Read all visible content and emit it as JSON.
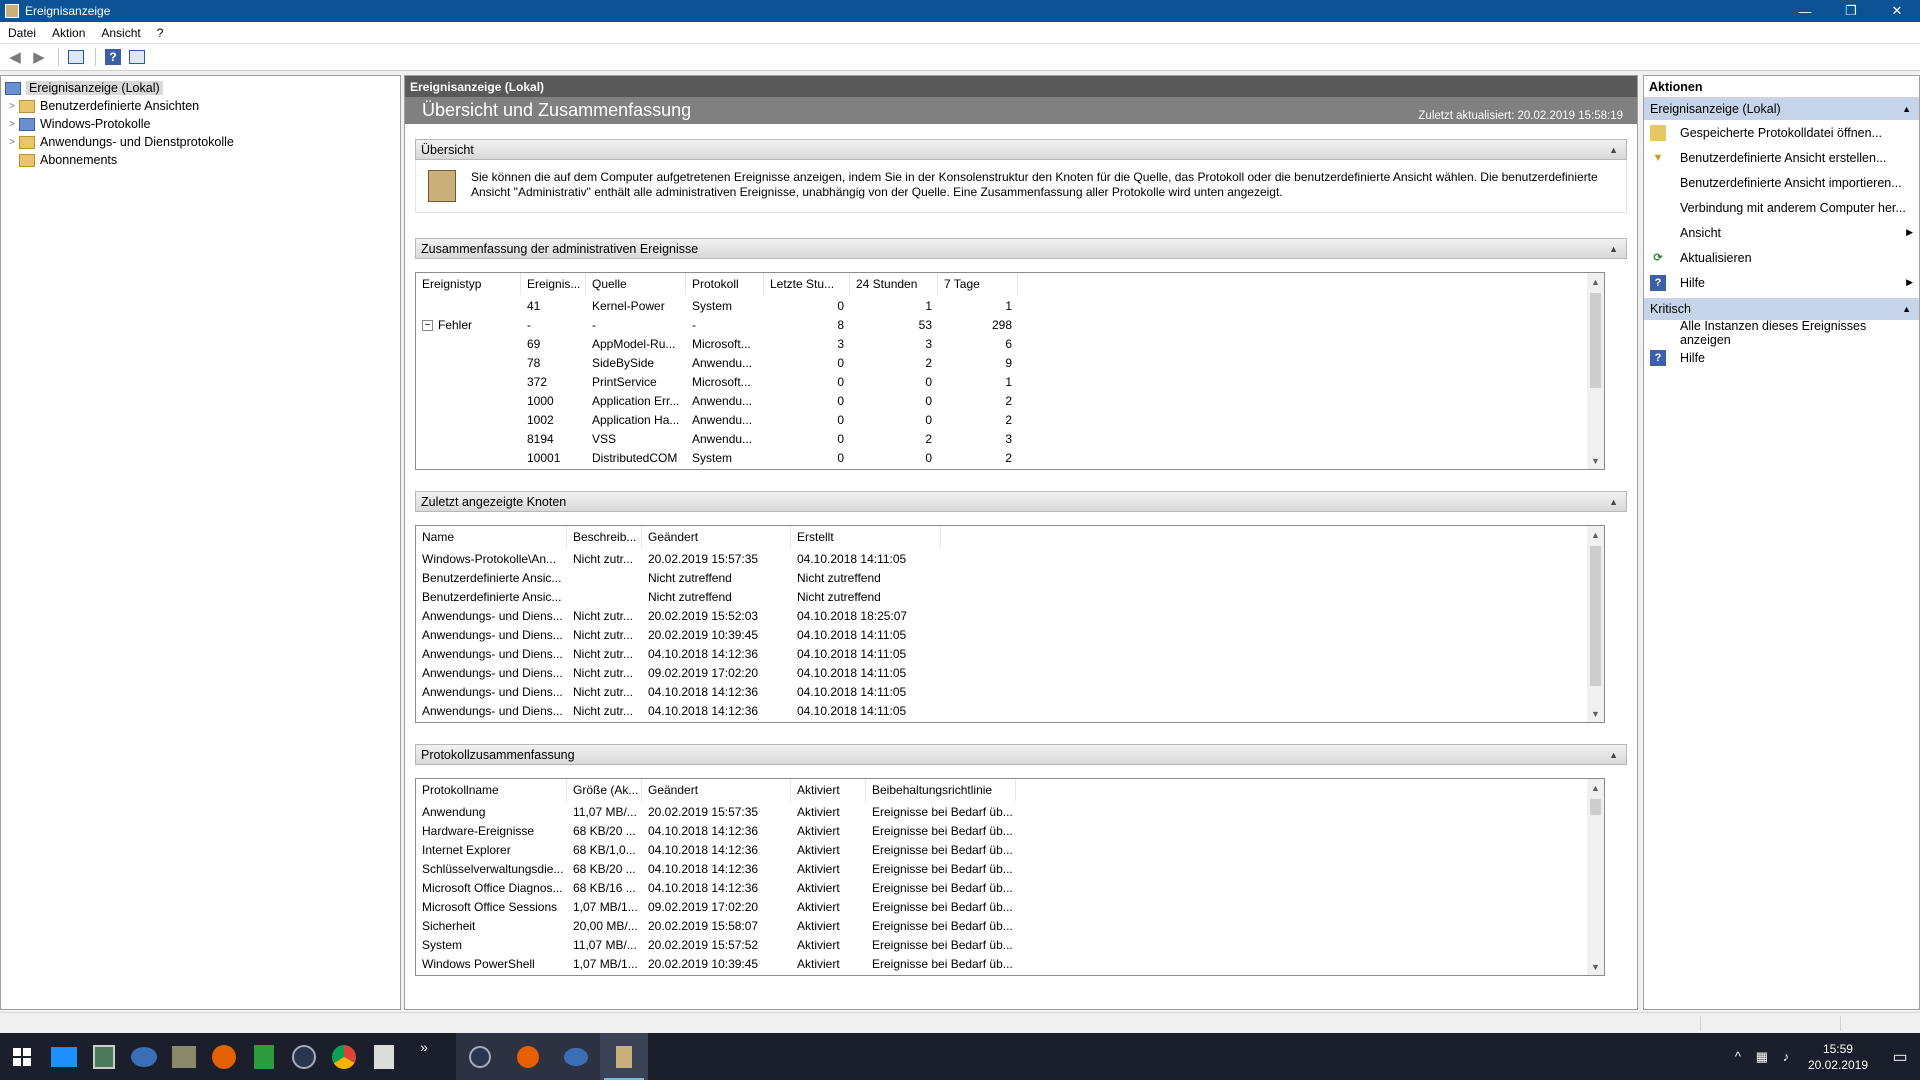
{
  "window": {
    "title": "Ereignisanzeige",
    "minimize": "—",
    "restore": "❐",
    "close": "✕"
  },
  "menu": [
    "Datei",
    "Aktion",
    "Ansicht",
    "?"
  ],
  "toolbar": {
    "back": "◀",
    "forward": "▶",
    "help": "?"
  },
  "tree": {
    "items": [
      {
        "label": "Ereignisanzeige (Lokal)",
        "expander": ""
      },
      {
        "label": "Benutzerdefinierte Ansichten",
        "expander": ">"
      },
      {
        "label": "Windows-Protokolle",
        "expander": ">"
      },
      {
        "label": "Anwendungs- und Dienstprotokolle",
        "expander": ">"
      },
      {
        "label": "Abonnements",
        "expander": ""
      }
    ]
  },
  "center": {
    "header": "Ereignisanzeige (Lokal)",
    "banner_title": "Übersicht und Zusammenfassung",
    "banner_date": "Zuletzt aktualisiert: 20.02.2019 15:58:19",
    "overview": {
      "title": "Übersicht",
      "text": "Sie können die auf dem Computer aufgetretenen Ereignisse anzeigen, indem Sie in der Konsolenstruktur den Knoten für die Quelle, das Protokoll oder die benutzerdefinierte Ansicht wählen. Die benutzerdefinierte Ansicht \"Administrativ\" enthält alle administrativen Ereignisse, unabhängig von der Quelle. Eine Zusammenfassung aller Protokolle wird unten angezeigt."
    },
    "admin_summary": {
      "title": "Zusammenfassung der administrativen Ereignisse",
      "columns": [
        "Ereignistyp",
        "Ereignis...",
        "Quelle",
        "Protokoll",
        "Letzte Stu...",
        "24 Stunden",
        "7 Tage"
      ],
      "rows": [
        [
          "",
          "41",
          "Kernel-Power",
          "System",
          "0",
          "1",
          "1"
        ],
        [
          "Fehler",
          "-",
          "-",
          "-",
          "8",
          "53",
          "298"
        ],
        [
          "",
          "69",
          "AppModel-Ru...",
          "Microsoft...",
          "3",
          "3",
          "6"
        ],
        [
          "",
          "78",
          "SideBySide",
          "Anwendu...",
          "0",
          "2",
          "9"
        ],
        [
          "",
          "372",
          "PrintService",
          "Microsoft...",
          "0",
          "0",
          "1"
        ],
        [
          "",
          "1000",
          "Application Err...",
          "Anwendu...",
          "0",
          "0",
          "2"
        ],
        [
          "",
          "1002",
          "Application Ha...",
          "Anwendu...",
          "0",
          "0",
          "2"
        ],
        [
          "",
          "8194",
          "VSS",
          "Anwendu...",
          "0",
          "2",
          "3"
        ],
        [
          "",
          "10001",
          "DistributedCOM",
          "System",
          "0",
          "0",
          "2"
        ]
      ]
    },
    "recent_nodes": {
      "title": "Zuletzt angezeigte Knoten",
      "columns": [
        "Name",
        "Beschreib...",
        "Geändert",
        "Erstellt"
      ],
      "rows": [
        [
          "Windows-Protokolle\\An...",
          "Nicht zutr...",
          "20.02.2019 15:57:35",
          "04.10.2018 14:11:05"
        ],
        [
          "Benutzerdefinierte Ansic...",
          "",
          "Nicht zutreffend",
          "Nicht zutreffend"
        ],
        [
          "Benutzerdefinierte Ansic...",
          "",
          "Nicht zutreffend",
          "Nicht zutreffend"
        ],
        [
          "Anwendungs- und Diens...",
          "Nicht zutr...",
          "20.02.2019 15:52:03",
          "04.10.2018 18:25:07"
        ],
        [
          "Anwendungs- und Diens...",
          "Nicht zutr...",
          "20.02.2019 10:39:45",
          "04.10.2018 14:11:05"
        ],
        [
          "Anwendungs- und Diens...",
          "Nicht zutr...",
          "04.10.2018 14:12:36",
          "04.10.2018 14:11:05"
        ],
        [
          "Anwendungs- und Diens...",
          "Nicht zutr...",
          "09.02.2019 17:02:20",
          "04.10.2018 14:11:05"
        ],
        [
          "Anwendungs- und Diens...",
          "Nicht zutr...",
          "04.10.2018 14:12:36",
          "04.10.2018 14:11:05"
        ],
        [
          "Anwendungs- und Diens...",
          "Nicht zutr...",
          "04.10.2018 14:12:36",
          "04.10.2018 14:11:05"
        ]
      ]
    },
    "log_summary": {
      "title": "Protokollzusammenfassung",
      "columns": [
        "Protokollname",
        "Größe (Ak...",
        "Geändert",
        "Aktiviert",
        "Beibehaltungsrichtlinie"
      ],
      "rows": [
        [
          "Anwendung",
          "11,07 MB/...",
          "20.02.2019 15:57:35",
          "Aktiviert",
          "Ereignisse bei Bedarf üb..."
        ],
        [
          "Hardware-Ereignisse",
          "68 KB/20 ...",
          "04.10.2018 14:12:36",
          "Aktiviert",
          "Ereignisse bei Bedarf üb..."
        ],
        [
          "Internet Explorer",
          "68 KB/1,0...",
          "04.10.2018 14:12:36",
          "Aktiviert",
          "Ereignisse bei Bedarf üb..."
        ],
        [
          "Schlüsselverwaltungsdie...",
          "68 KB/20 ...",
          "04.10.2018 14:12:36",
          "Aktiviert",
          "Ereignisse bei Bedarf üb..."
        ],
        [
          "Microsoft Office Diagnos...",
          "68 KB/16 ...",
          "04.10.2018 14:12:36",
          "Aktiviert",
          "Ereignisse bei Bedarf üb..."
        ],
        [
          "Microsoft Office Sessions",
          "1,07 MB/1...",
          "09.02.2019 17:02:20",
          "Aktiviert",
          "Ereignisse bei Bedarf üb..."
        ],
        [
          "Sicherheit",
          "20,00 MB/...",
          "20.02.2019 15:58:07",
          "Aktiviert",
          "Ereignisse bei Bedarf üb..."
        ],
        [
          "System",
          "11,07 MB/...",
          "20.02.2019 15:57:52",
          "Aktiviert",
          "Ereignisse bei Bedarf üb..."
        ],
        [
          "Windows PowerShell",
          "1,07 MB/1...",
          "20.02.2019 10:39:45",
          "Aktiviert",
          "Ereignisse bei Bedarf üb..."
        ]
      ]
    }
  },
  "actions": {
    "title": "Aktionen",
    "group1": "Ereignisanzeige (Lokal)",
    "items1": [
      {
        "label": "Gespeicherte Protokolldatei öffnen...",
        "icon": "folder-icon"
      },
      {
        "label": "Benutzerdefinierte Ansicht erstellen...",
        "icon": "filter-icon"
      },
      {
        "label": "Benutzerdefinierte Ansicht importieren...",
        "icon": ""
      },
      {
        "label": "Verbindung mit anderem Computer her...",
        "icon": ""
      },
      {
        "label": "Ansicht",
        "icon": "",
        "submenu": true
      },
      {
        "label": "Aktualisieren",
        "icon": "refresh-icon"
      },
      {
        "label": "Hilfe",
        "icon": "help-icon",
        "submenu": true
      }
    ],
    "group2": "Kritisch",
    "items2": [
      {
        "label": "Alle Instanzen dieses Ereignisses anzeigen",
        "icon": ""
      },
      {
        "label": "Hilfe",
        "icon": "help-icon"
      }
    ]
  },
  "taskbar": {
    "clock_time": "15:59",
    "clock_date": "20.02.2019",
    "apps": [
      "start-icon",
      "explorer-icon",
      "calculator-icon",
      "thunderbird-icon",
      "tools-icon",
      "firefox-icon",
      "spreadsheet-icon",
      "keepass-icon",
      "chrome-icon",
      "recycle-icon"
    ],
    "overflow": "»"
  },
  "colors": {
    "titlebar": "#0b5394",
    "group_header": "#c5d4e8",
    "taskbar": "#1a1f2b"
  }
}
